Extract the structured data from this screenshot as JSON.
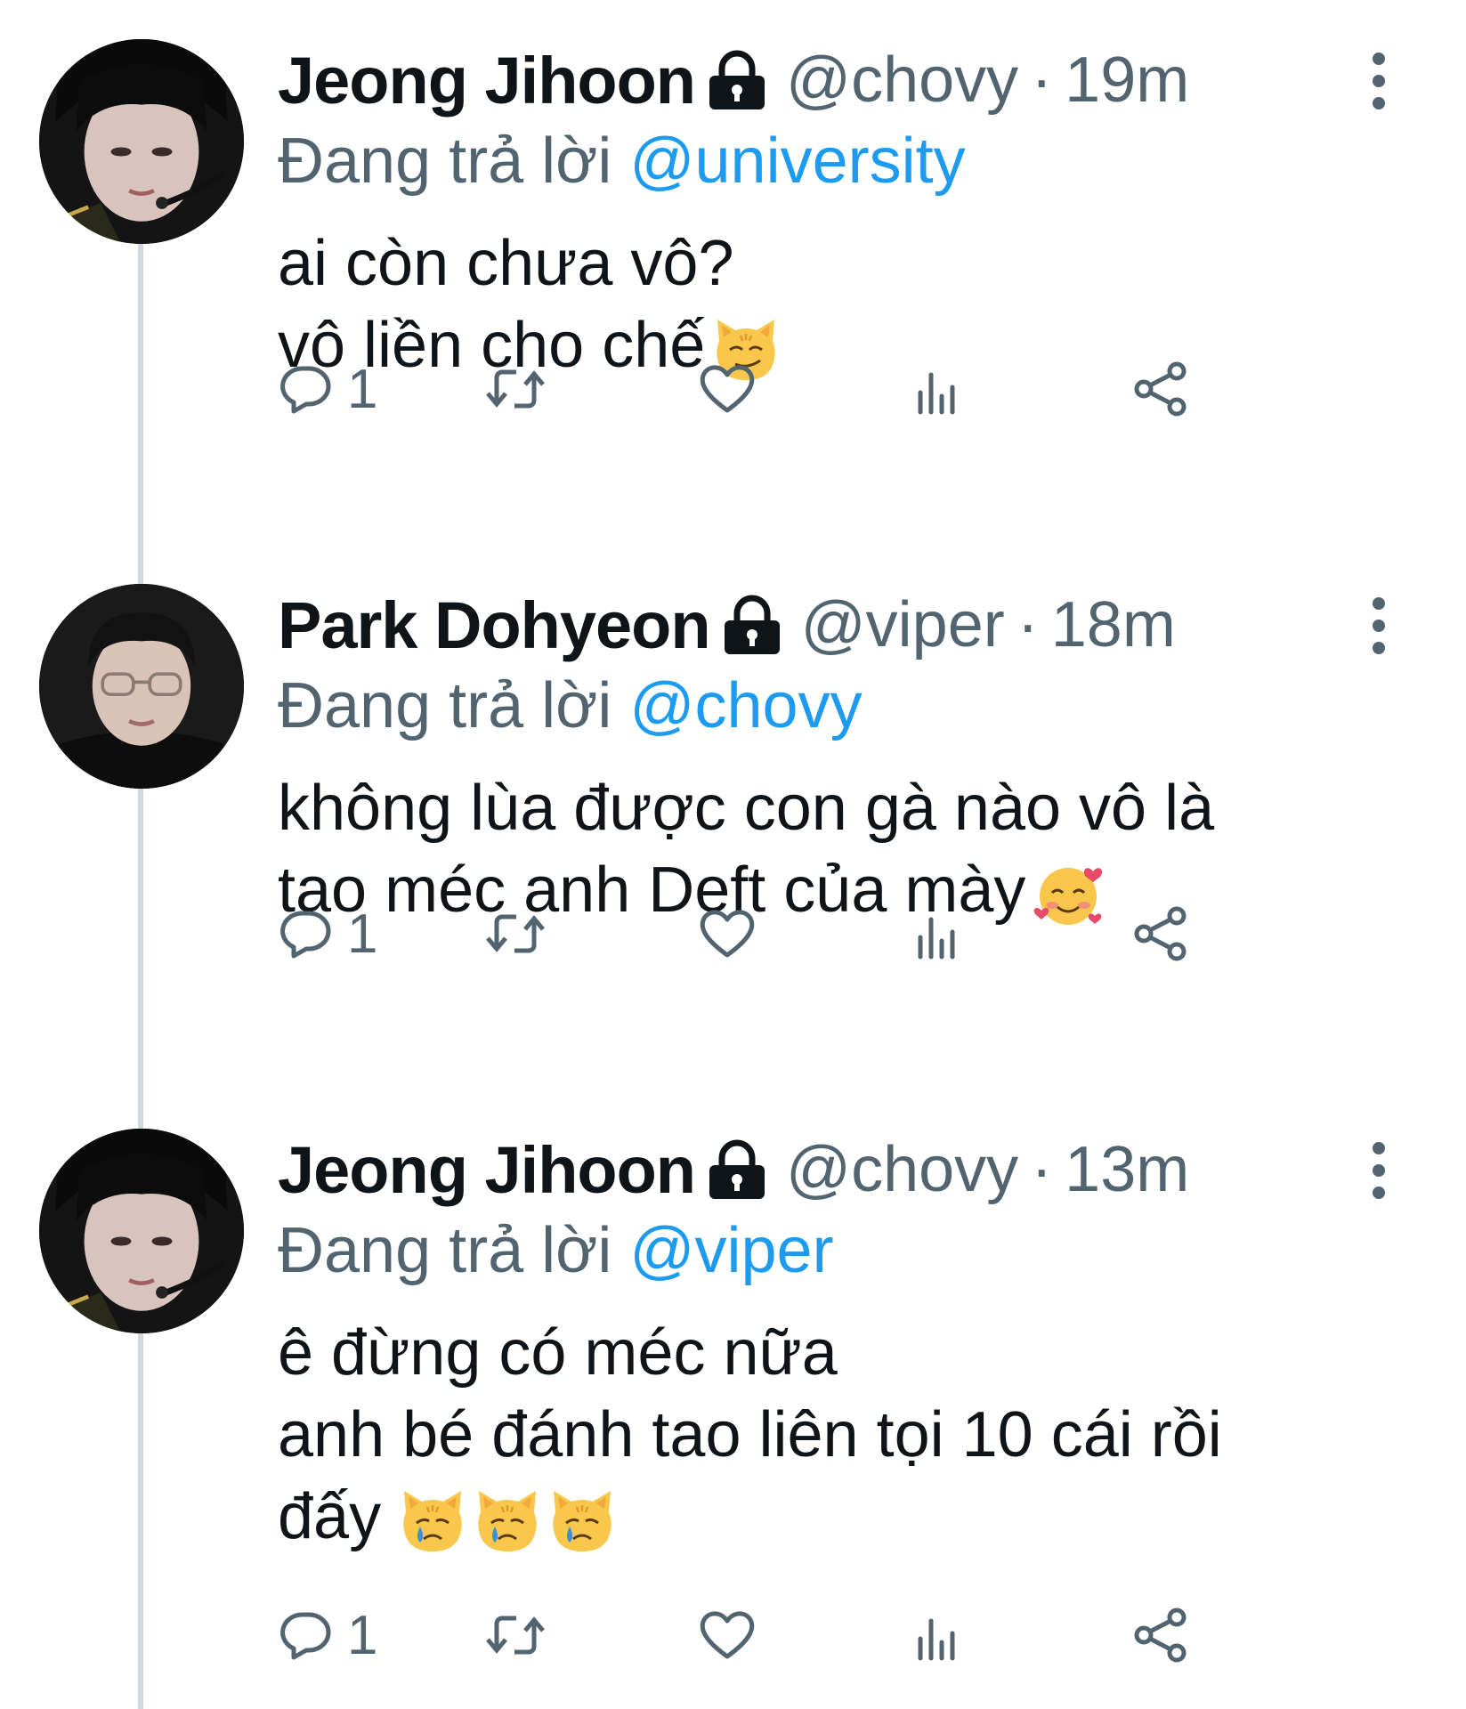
{
  "tweets": [
    {
      "display_name": "Jeong Jihoon",
      "handle": "@chovy",
      "separator": "·",
      "time": "19m",
      "reply_prefix": "Đang trả lời",
      "reply_to": "@university",
      "lines": [
        "ai còn chưa vô?",
        "vô liền cho chế"
      ],
      "emojis": [
        "smirking-cat-emoji"
      ],
      "reply_count": "1",
      "avatar_icon": "avatar-chovy"
    },
    {
      "display_name": "Park Dohyeon",
      "handle": "@viper",
      "separator": "·",
      "time": "18m",
      "reply_prefix": "Đang trả lời",
      "reply_to": "@chovy",
      "lines": [
        "không lùa được con gà nào vô là",
        "tao méc anh Deft của mày"
      ],
      "emojis": [
        "smiling-face-with-hearts-emoji"
      ],
      "reply_count": "1",
      "avatar_icon": "avatar-viper"
    },
    {
      "display_name": "Jeong Jihoon",
      "handle": "@chovy",
      "separator": "·",
      "time": "13m",
      "reply_prefix": "Đang trả lời",
      "reply_to": "@viper",
      "lines": [
        "ê đừng có méc nữa",
        "anh bé đánh tao liên tọi 10 cái rồi",
        "đấy"
      ],
      "emojis": [
        "crying-cat-emoji",
        "crying-cat-emoji",
        "crying-cat-emoji"
      ],
      "reply_count": "1",
      "avatar_icon": "avatar-chovy"
    }
  ],
  "colors": {
    "text_primary": "#0f1419",
    "text_secondary": "#536471",
    "link": "#1d9bf0",
    "thread_line": "#cfd9de"
  },
  "icons": [
    "lock-icon",
    "more-icon",
    "reply-icon",
    "retweet-icon",
    "like-icon",
    "views-icon",
    "share-icon"
  ]
}
